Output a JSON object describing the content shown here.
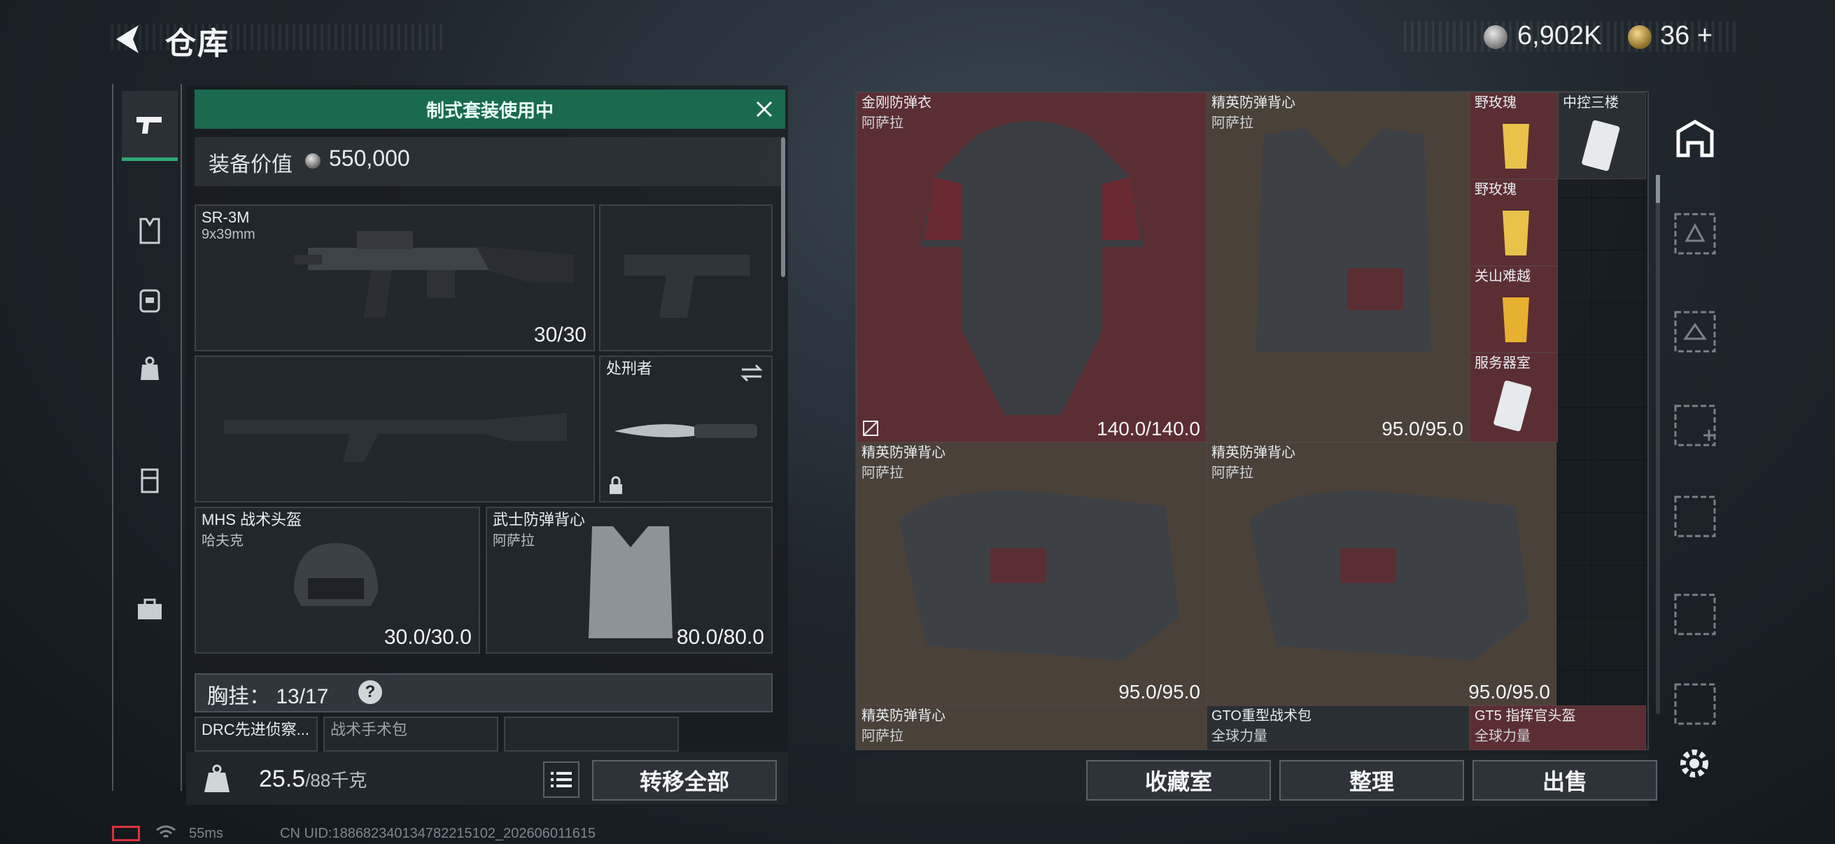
{
  "topbar": {
    "title": "仓库"
  },
  "currency": {
    "silver": "6,902K",
    "gold": "36",
    "gold_plus": "+"
  },
  "loadout": {
    "banner": "制式套装使用中",
    "equip_value_label": "装备价值",
    "equip_value": "550,000",
    "primary": {
      "name": "SR-3M",
      "caliber": "9x39mm",
      "ammo": "30/30"
    },
    "melee": {
      "name": "处刑者"
    },
    "helmet": {
      "name": "MHS 战术头盔",
      "brand": "哈夫克",
      "durability": "30.0/30.0"
    },
    "armor": {
      "name": "武士防弹背心",
      "brand": "阿萨拉",
      "durability": "80.0/80.0"
    },
    "chest_rig": {
      "label": "胸挂：",
      "count": "13/17",
      "help": "?"
    },
    "peek_items": [
      "DRC先进侦察...",
      "战术手术包"
    ]
  },
  "weight": {
    "current": "25.5",
    "max": "/88千克"
  },
  "buttons": {
    "transfer_all": "转移全部",
    "collection": "收藏室",
    "organize": "整理",
    "sell": "出售"
  },
  "stash": {
    "items": [
      {
        "name": "金刚防弹衣",
        "brand": "阿萨拉",
        "durability": "140.0/140.0"
      },
      {
        "name": "精英防弹背心",
        "brand": "阿萨拉",
        "durability": "95.0/95.0"
      },
      {
        "name": "野玫瑰"
      },
      {
        "name": "中控三楼"
      },
      {
        "name": "野玫瑰"
      },
      {
        "name": "关山难越"
      },
      {
        "name": "服务器室"
      },
      {
        "name": "精英防弹背心",
        "brand": "阿萨拉",
        "durability": "95.0/95.0"
      },
      {
        "name": "精英防弹背心",
        "brand": "阿萨拉",
        "durability": "95.0/95.0"
      },
      {
        "name": "精英防弹背心",
        "brand": "阿萨拉"
      },
      {
        "name": "GTO重型战术包",
        "brand": "全球力量"
      },
      {
        "name": "GT5 指挥官头盔",
        "brand": "全球力量"
      }
    ]
  },
  "status": {
    "ping": "55ms",
    "uid": "CN UID:18868234013478221510​2_202606011615"
  }
}
